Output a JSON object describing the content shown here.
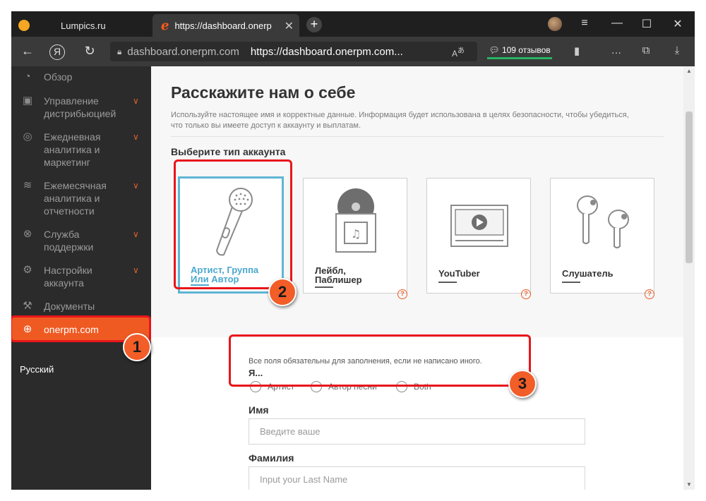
{
  "browser": {
    "tabs": [
      {
        "label": "Lumpics.ru"
      },
      {
        "label": "https://dashboard.onerp"
      }
    ],
    "new_tab": "+",
    "address": {
      "domain": "dashboard.onerpm.com",
      "url": "https://dashboard.onerpm.com...",
      "reviews": "109 отзывов"
    },
    "colors": {
      "accent": "#ef5a22",
      "reviews_bar": "#28b463"
    }
  },
  "sidebar": {
    "items": [
      {
        "label": "Обзор",
        "icon": "gauge-icon"
      },
      {
        "label": "Управление дистрибьюцией",
        "icon": "distribution-icon"
      },
      {
        "label": "Ежедневная аналитика и маркетинг",
        "icon": "target-icon"
      },
      {
        "label": "Ежемесячная аналитика и отчетности",
        "icon": "coins-icon"
      },
      {
        "label": "Служба поддержки",
        "icon": "lifebuoy-icon"
      },
      {
        "label": "Настройки аккаунта",
        "icon": "gear-icon"
      },
      {
        "label": "Документы",
        "icon": "gavel-icon"
      },
      {
        "label": "onerpm.com",
        "icon": "globe-icon"
      }
    ],
    "language": "Русский"
  },
  "main": {
    "title": "Расскажите нам о себе",
    "description": "Используйте настоящее имя и корректные данные. Информация будет использована в целях безопасности, чтобы убедиться, что только вы имеете доступ к аккаунту и выплатам.",
    "account_type_title": "Выберите тип аккаунта",
    "account_types": [
      {
        "label": "Артист, Группа Или Автор",
        "icon": "microphone-icon",
        "selected": true
      },
      {
        "label": "Лейбл, Паблишер",
        "icon": "vinyl-record-icon",
        "selected": false
      },
      {
        "label": "YouTuber",
        "icon": "video-player-icon",
        "selected": false
      },
      {
        "label": "Слушатель",
        "icon": "earbuds-icon",
        "selected": false
      }
    ],
    "help_glyph": "?",
    "form": {
      "required_note": "Все поля обязательны для заполнения, если не написано иного.",
      "i_am_label": "Я...",
      "role_options": [
        "Артист",
        "Автор песни",
        "Both"
      ],
      "first_name_label": "Имя",
      "first_name_placeholder": "Введите ваше",
      "last_name_label": "Фамилия",
      "last_name_placeholder": "Input your Last Name"
    }
  },
  "annotations": {
    "badges": [
      "1",
      "2",
      "3"
    ],
    "highlight_color": "#e8151b"
  }
}
